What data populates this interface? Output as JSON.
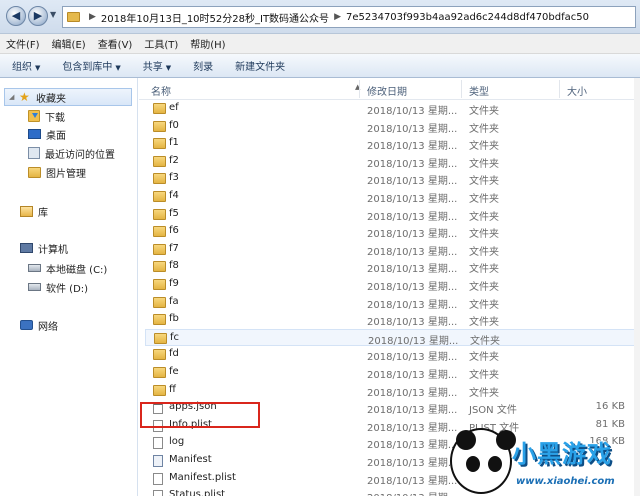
{
  "address": {
    "segments": [
      "2018年10月13日_10时52分28秒_IT数码通公众号",
      "7e5234703f993b4aa92ad6c244d8df470bdfac50"
    ]
  },
  "menu": [
    "文件(F)",
    "编辑(E)",
    "查看(V)",
    "工具(T)",
    "帮助(H)"
  ],
  "toolbar": {
    "organize": "组织",
    "include_library": "包含到库中",
    "share": "共享",
    "burn": "刻录",
    "new_folder": "新建文件夹"
  },
  "nav": {
    "favorites": "收藏夹",
    "downloads": "下载",
    "desktop": "桌面",
    "recent": "最近访问的位置",
    "pictures": "图片管理",
    "libraries": "库",
    "computer": "计算机",
    "drive_c": "本地磁盘 (C:)",
    "drive_d": "软件 (D:)",
    "network": "网络"
  },
  "columns": {
    "name": "名称",
    "date": "修改日期",
    "type": "类型",
    "size": "大小"
  },
  "rows": [
    {
      "name": "ef",
      "date": "2018/10/13 星期...",
      "type": "文件夹",
      "size": ""
    },
    {
      "name": "f0",
      "date": "2018/10/13 星期...",
      "type": "文件夹",
      "size": ""
    },
    {
      "name": "f1",
      "date": "2018/10/13 星期...",
      "type": "文件夹",
      "size": ""
    },
    {
      "name": "f2",
      "date": "2018/10/13 星期...",
      "type": "文件夹",
      "size": ""
    },
    {
      "name": "f3",
      "date": "2018/10/13 星期...",
      "type": "文件夹",
      "size": ""
    },
    {
      "name": "f4",
      "date": "2018/10/13 星期...",
      "type": "文件夹",
      "size": ""
    },
    {
      "name": "f5",
      "date": "2018/10/13 星期...",
      "type": "文件夹",
      "size": ""
    },
    {
      "name": "f6",
      "date": "2018/10/13 星期...",
      "type": "文件夹",
      "size": ""
    },
    {
      "name": "f7",
      "date": "2018/10/13 星期...",
      "type": "文件夹",
      "size": ""
    },
    {
      "name": "f8",
      "date": "2018/10/13 星期...",
      "type": "文件夹",
      "size": ""
    },
    {
      "name": "f9",
      "date": "2018/10/13 星期...",
      "type": "文件夹",
      "size": ""
    },
    {
      "name": "fa",
      "date": "2018/10/13 星期...",
      "type": "文件夹",
      "size": ""
    },
    {
      "name": "fb",
      "date": "2018/10/13 星期...",
      "type": "文件夹",
      "size": ""
    },
    {
      "name": "fc",
      "date": "2018/10/13 星期...",
      "type": "文件夹",
      "size": ""
    },
    {
      "name": "fd",
      "date": "2018/10/13 星期...",
      "type": "文件夹",
      "size": ""
    },
    {
      "name": "fe",
      "date": "2018/10/13 星期...",
      "type": "文件夹",
      "size": ""
    },
    {
      "name": "ff",
      "date": "2018/10/13 星期...",
      "type": "文件夹",
      "size": ""
    },
    {
      "name": "apps.json",
      "date": "2018/10/13 星期...",
      "type": "JSON 文件",
      "size": "16 KB"
    },
    {
      "name": "Info.plist",
      "date": "2018/10/13 星期...",
      "type": "PLIST 文件",
      "size": "81 KB"
    },
    {
      "name": "log",
      "date": "2018/10/13 星期...",
      "type": "文本文档",
      "size": "168 KB"
    },
    {
      "name": "Manifest",
      "date": "2018/10/13 星期...",
      "type": "",
      "size": ""
    },
    {
      "name": "Manifest.plist",
      "date": "2018/10/13 星期...",
      "type": "",
      "size": ""
    },
    {
      "name": "Status.plist",
      "date": "2018/10/13 星期...",
      "type": "",
      "size": ""
    }
  ],
  "watermark": {
    "title": "小黑游戏",
    "url": "www.xiaohei.com"
  }
}
